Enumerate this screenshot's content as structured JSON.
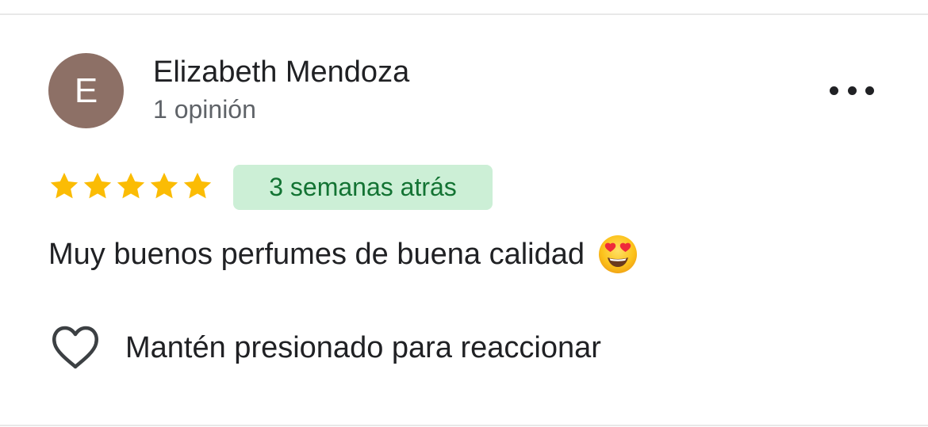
{
  "review": {
    "avatar_initial": "E",
    "avatar_color": "#8d7066",
    "author_name": "Elizabeth Mendoza",
    "review_count": "1 opinión",
    "rating": 5,
    "rating_max": 5,
    "star_color": "#fbbc04",
    "date": "3 semanas atrás",
    "date_badge_color": "#ccefd6",
    "date_text_color": "#137333",
    "text": "Muy buenos perfumes de buena calidad",
    "emoji": "smiling-face-with-heart-eyes-icon"
  },
  "actions": {
    "more_icon": "more-horizontal-icon",
    "react_icon": "heart-outline-icon",
    "react_label": "Mantén presionado para reaccionar"
  }
}
